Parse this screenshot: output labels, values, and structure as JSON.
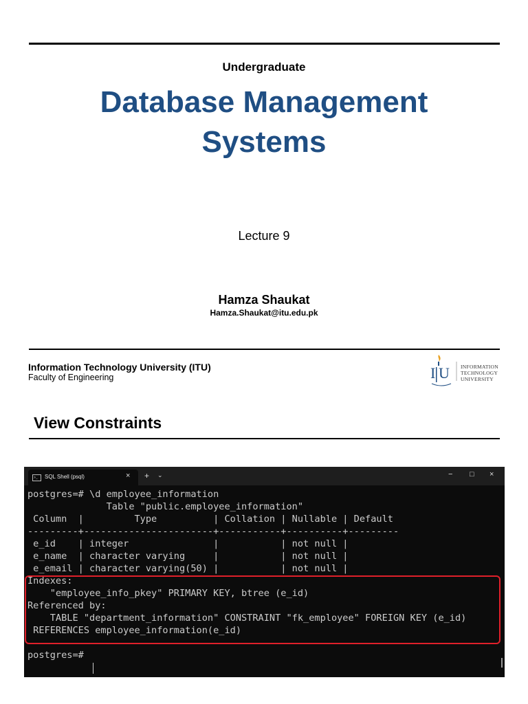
{
  "header": {
    "subtitle": "Undergraduate",
    "title_line1": "Database Management",
    "title_line2": "Systems",
    "lecture": "Lecture 9",
    "author": "Hamza Shaukat",
    "email": "Hamza.Shaukat@itu.edu.pk"
  },
  "footer": {
    "institution": "Information Technology University (ITU)",
    "faculty": "Faculty of Engineering",
    "logo_text_1": "INFORMATION",
    "logo_text_2": "TECHNOLOGY",
    "logo_text_3": "UNIVERSITY"
  },
  "section_title": "View Constraints",
  "terminal": {
    "tab_label": "SQL Shell (psql)",
    "tab_close": "×",
    "new_tab": "+",
    "dropdown": "⌄",
    "minimize": "−",
    "maximize": "□",
    "close": "×",
    "lines": [
      "postgres=# \\d employee_information",
      "              Table \"public.employee_information\"",
      " Column  |         Type          | Collation | Nullable | Default",
      "---------+-----------------------+-----------+----------+---------",
      " e_id    | integer               |           | not null |",
      " e_name  | character varying     |           | not null |",
      " e_email | character varying(50) |           | not null |",
      "Indexes:",
      "    \"employee_info_pkey\" PRIMARY KEY, btree (e_id)",
      "Referenced by:",
      "    TABLE \"department_information\" CONSTRAINT \"fk_employee\" FOREIGN KEY (e_id)",
      " REFERENCES employee_information(e_id)",
      "",
      "postgres=# "
    ]
  },
  "colors": {
    "title": "#1f4e83",
    "terminal_bg": "#0c0c0c",
    "terminal_text": "#cccccc",
    "highlight_border": "#e0202a"
  }
}
